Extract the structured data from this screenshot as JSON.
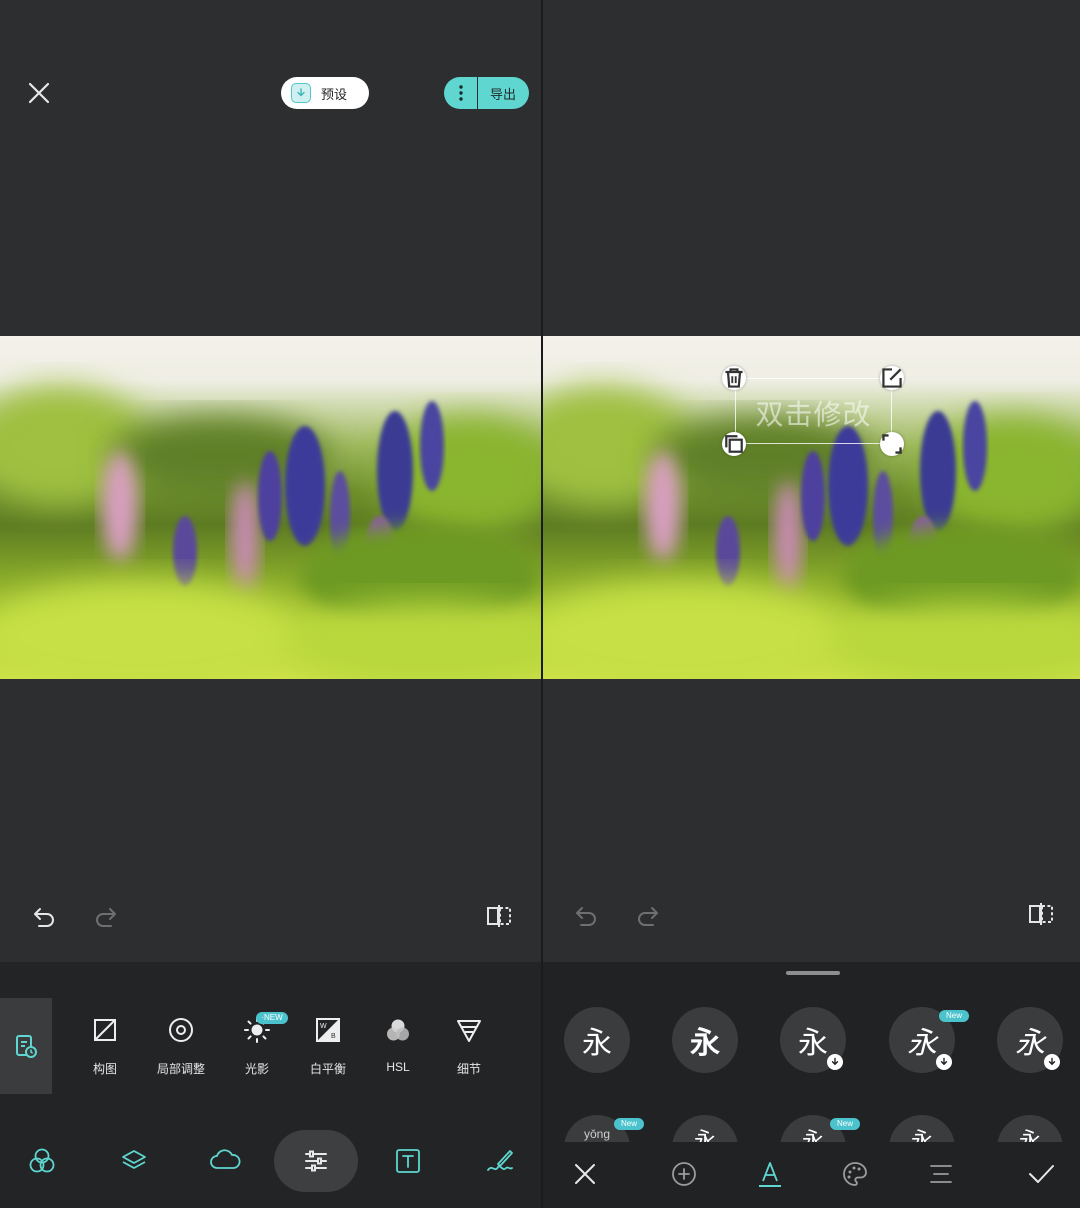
{
  "left": {
    "preset_label": "预设",
    "export_label": "导出",
    "tools": [
      {
        "id": "crop",
        "label": "构图"
      },
      {
        "id": "local",
        "label": "局部调整"
      },
      {
        "id": "light",
        "label": "光影"
      },
      {
        "id": "wb",
        "label": "白平衡"
      },
      {
        "id": "hsl",
        "label": "HSL"
      },
      {
        "id": "detail",
        "label": "细节"
      }
    ],
    "new_badge": "·NEW",
    "nav": [
      "filters",
      "layers",
      "sky",
      "adjust",
      "text",
      "draw"
    ],
    "active_nav": "adjust"
  },
  "right": {
    "text_placeholder": "双击修改",
    "fonts_row1": [
      "永",
      "永",
      "永",
      "永",
      "永"
    ],
    "font_new_badge": "New",
    "fonts_row2_partial": [
      "yǒng",
      "永",
      "永",
      "永",
      "永"
    ],
    "bottom_tabs": [
      "cancel",
      "add",
      "font",
      "color",
      "align",
      "confirm"
    ],
    "active_tab": "font"
  },
  "colors": {
    "accent": "#5fd6cf",
    "background": "#2c2e30",
    "sheet": "#232426",
    "badge": "#4bc3cc"
  }
}
